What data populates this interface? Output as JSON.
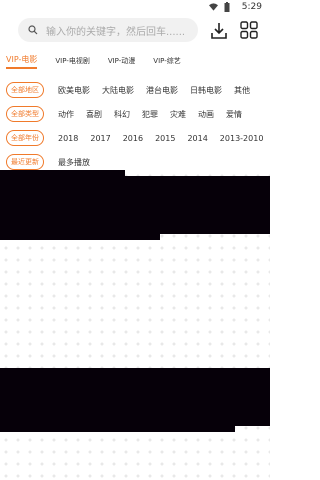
{
  "status_bar": {
    "time": "5:29"
  },
  "search": {
    "placeholder": "输入你的关键字，然后回车......"
  },
  "tabs": [
    "VIP-电影",
    "VIP-电视剧",
    "VIP-动漫",
    "VIP-综艺"
  ],
  "filters": [
    {
      "label": "全部地区",
      "options": [
        "欧美电影",
        "大陆电影",
        "港台电影",
        "日韩电影",
        "其他"
      ]
    },
    {
      "label": "全部类型",
      "options": [
        "动作",
        "喜剧",
        "科幻",
        "犯罪",
        "灾难",
        "动画",
        "爱情"
      ]
    },
    {
      "label": "全部年份",
      "options": [
        "2018",
        "2017",
        "2016",
        "2015",
        "2014",
        "2013-2010"
      ]
    },
    {
      "label": "最近更新",
      "options": [
        "最多播放"
      ]
    }
  ]
}
